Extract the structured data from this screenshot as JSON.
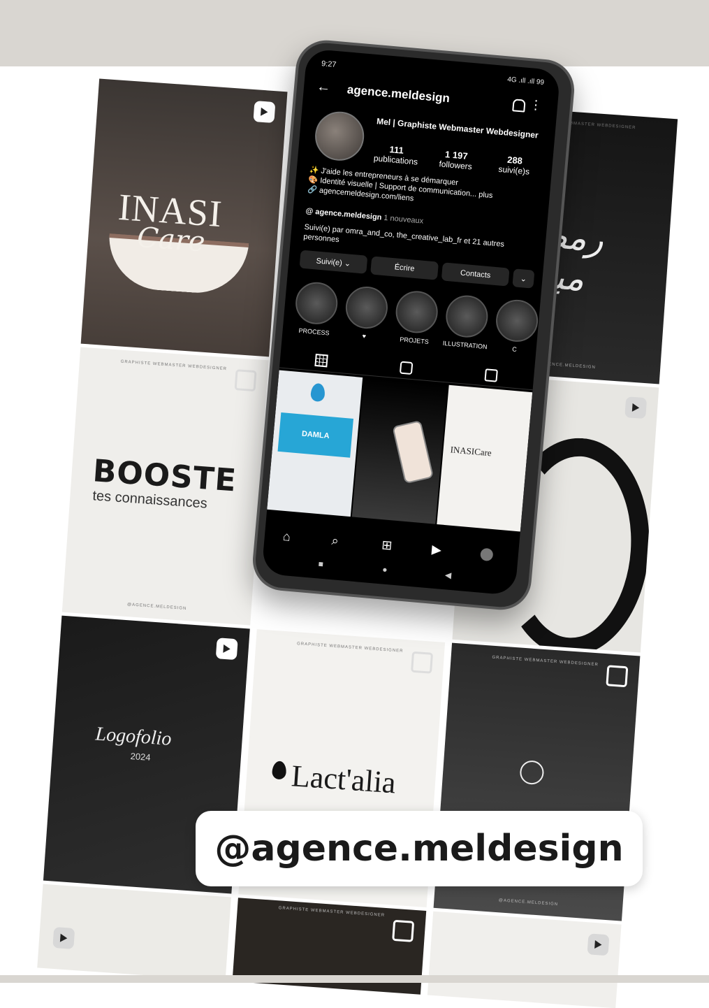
{
  "handle_label": "@agence.meldesign",
  "feed": {
    "caption_top": "GRAPHISTE  WEBMASTER  WEBDESIGNER",
    "caption_bottom": "@AGENCE.MELDESIGN",
    "inasi": {
      "brand": "INASI",
      "script": "Care"
    },
    "booste": {
      "big": "BOOSTE",
      "sub": "tes connaissances"
    },
    "logofolio": {
      "title": "Logofolio",
      "year": "2024"
    },
    "lactalia": {
      "name": "Lact'alia"
    }
  },
  "phone": {
    "status_time": "9:27",
    "status_right": "4G .ıll .ıll  99",
    "username": "agence.meldesign",
    "profile_name": "Mel | Graphiste Webmaster Webdesigner",
    "stats": [
      {
        "value": "111",
        "label": "publications"
      },
      {
        "value": "1 197",
        "label": "followers"
      },
      {
        "value": "288",
        "label": "suivi(e)s"
      }
    ],
    "bio": [
      "✨ J'aide les entrepreneurs à se démarquer",
      "🎨 Identité visuelle | Support de communication... plus",
      "🔗 agencemeldesign.com/liens"
    ],
    "threads_handle": "agence.meldesign",
    "threads_note": "1 nouveaux",
    "followed_by": "Suivi(e) par omra_and_co, the_creative_lab_fr et 21 autres personnes",
    "buttons": [
      "Suivi(e) ⌄",
      "Écrire",
      "Contacts",
      "⌄"
    ],
    "highlights": [
      "PROCESS",
      "♥",
      "PROJETS",
      "ILLUSTRATION",
      "C"
    ],
    "posts": {
      "damla": "DAMLA",
      "inasi": "INASICare"
    }
  },
  "colors": {
    "band": "#d9d6d1",
    "screen": "#000000",
    "accent_blue": "#27a6d6"
  }
}
